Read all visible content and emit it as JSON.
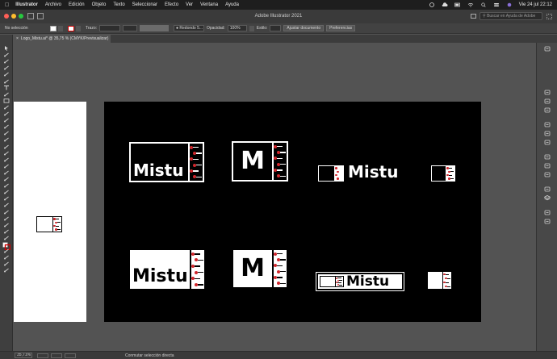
{
  "menubar": {
    "items": [
      "Illustrator",
      "Archivo",
      "Edición",
      "Objeto",
      "Texto",
      "Seleccionar",
      "Efecto",
      "Ver",
      "Ventana",
      "Ayuda"
    ],
    "clock": "Vie 24 jul  22:12"
  },
  "window": {
    "title": "Adobe Illustrator 2021",
    "search_placeholder": "Buscar en Ayuda de Adobe"
  },
  "controlbar": {
    "selection": "No selección",
    "stroke_label": "Trazo:",
    "brush_value": "Redondo 5...",
    "opacity_label": "Opacidad:",
    "opacity_value": "100%",
    "style_label": "Estilo:",
    "document_setup_button": "Ajustar documento",
    "preferences_button": "Preferencias"
  },
  "document": {
    "tab_close": "×",
    "tab_label": "Logo_Mistu.ai* @ 35,75 % (CMYK/Previsualizar)"
  },
  "logos": {
    "word": "Mistu",
    "letter": "M"
  },
  "statusbar": {
    "zoom": "35,71%",
    "message": "Conmutar selección directa"
  },
  "colors": {
    "match_head": "#d0262c",
    "artboard_dark": "#000000",
    "artboard_light": "#ffffff",
    "ui_background": "#535353"
  }
}
